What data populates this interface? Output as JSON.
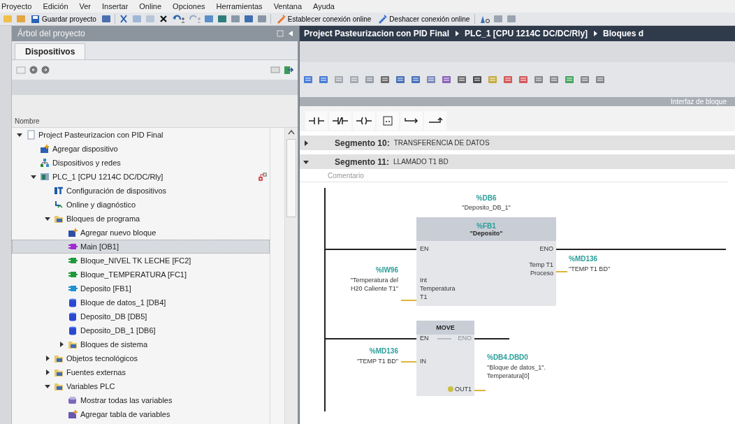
{
  "menu": [
    {
      "label": "Proyecto"
    },
    {
      "label": "Edición"
    },
    {
      "label": "Ver"
    },
    {
      "label": "Insertar"
    },
    {
      "label": "Online"
    },
    {
      "label": "Opciones"
    },
    {
      "label": "Herramientas"
    },
    {
      "label": "Ventana"
    },
    {
      "label": "Ayuda"
    }
  ],
  "toolbar": {
    "save_label": "Guardar proyecto",
    "connect_label": "Establecer conexión online",
    "disconnect_label": "Deshacer conexión online"
  },
  "project_tree": {
    "title": "Árbol del proyecto",
    "tabs": [
      {
        "label": "Dispositivos",
        "selected": true
      }
    ],
    "column": "Nombre",
    "items": [
      {
        "label": "Project Pasteurizacion con PID Final",
        "kind": "project",
        "expanded": true,
        "selected": false,
        "children": [
          {
            "label": "Agregar dispositivo",
            "kind": "add-device",
            "selected": false
          },
          {
            "label": "Dispositivos y redes",
            "kind": "network",
            "selected": false
          },
          {
            "label": "PLC_1 [CPU 1214C DC/DC/Rly]",
            "kind": "plc",
            "expanded": true,
            "selected": false,
            "children": [
              {
                "label": "Configuración de dispositivos",
                "kind": "config",
                "selected": false
              },
              {
                "label": "Online y diagnóstico",
                "kind": "diagnostics",
                "selected": false
              },
              {
                "label": "Bloques de programa",
                "kind": "folder",
                "expanded": true,
                "selected": false,
                "children": [
                  {
                    "label": "Agregar nuevo bloque",
                    "kind": "add-block",
                    "selected": false
                  },
                  {
                    "label": "Main [OB1]",
                    "kind": "ob",
                    "selected": true
                  },
                  {
                    "label": "Bloque_NIVEL TK LECHE [FC2]",
                    "kind": "fc",
                    "selected": false
                  },
                  {
                    "label": "Bloque_TEMPERATURA [FC1]",
                    "kind": "fc",
                    "selected": false
                  },
                  {
                    "label": "Deposito [FB1]",
                    "kind": "fb",
                    "selected": false
                  },
                  {
                    "label": "Bloque de datos_1 [DB4]",
                    "kind": "db",
                    "selected": false
                  },
                  {
                    "label": "Deposito_DB [DB5]",
                    "kind": "db",
                    "selected": false
                  },
                  {
                    "label": "Deposito_DB_1 [DB6]",
                    "kind": "db",
                    "selected": false
                  },
                  {
                    "label": "Bloques de sistema",
                    "kind": "folder",
                    "expanded": false,
                    "selected": false
                  }
                ]
              },
              {
                "label": "Objetos tecnológicos",
                "kind": "folder",
                "expanded": false,
                "selected": false
              },
              {
                "label": "Fuentes externas",
                "kind": "folder",
                "expanded": false,
                "selected": false
              },
              {
                "label": "Variables PLC",
                "kind": "folder",
                "expanded": true,
                "selected": false,
                "children": [
                  {
                    "label": "Mostrar todas las variables",
                    "kind": "tags",
                    "selected": false
                  },
                  {
                    "label": "Agregar tabla de variables",
                    "kind": "add-table",
                    "selected": false
                  }
                ]
              }
            ]
          }
        ]
      }
    ]
  },
  "editor": {
    "breadcrumb": [
      "Project Pasteurizacion con PID Final",
      "PLC_1 [CPU 1214C DC/DC/Rly]",
      "Bloques d"
    ],
    "interface_label": "Interfaz de bloque",
    "segments": [
      {
        "title": "Segmento 10:",
        "comment": "TRANSFERENCIA DE DATOS",
        "expanded": false
      },
      {
        "title": "Segmento 11:",
        "comment": "LLAMADO T1 BD",
        "expanded": true,
        "comment_placeholder": "Comentario"
      }
    ],
    "ladder": {
      "blocks": [
        {
          "kind": "fb",
          "instance_address": "%DB6",
          "instance_name": "\"Deposito_DB_1\"",
          "address": "%FB1",
          "name": "\"Deposito\"",
          "enable_in": "EN",
          "enable_out": "ENO",
          "enable_out_active": true,
          "inputs": [
            {
              "pin": "Int Temperatura T1",
              "address": "%IW96",
              "operand": "\"Temperatura del H20 Caliente T1\""
            }
          ],
          "outputs": [
            {
              "pin": "Temp T1 Proceso",
              "address": "%MD136",
              "operand": "\"TEMP T1 BD\""
            }
          ]
        },
        {
          "kind": "move",
          "name": "MOVE",
          "enable_in": "EN",
          "enable_out": "ENO",
          "enable_out_active": false,
          "inputs": [
            {
              "pin": "IN",
              "address": "%MD136",
              "operand": "\"TEMP T1 BD\""
            }
          ],
          "outputs": [
            {
              "pin": "OUT1",
              "address": "%DB4.DBD0",
              "operand": "\"Bloque de datos_1\". Temperatura[0]"
            }
          ]
        }
      ]
    }
  }
}
